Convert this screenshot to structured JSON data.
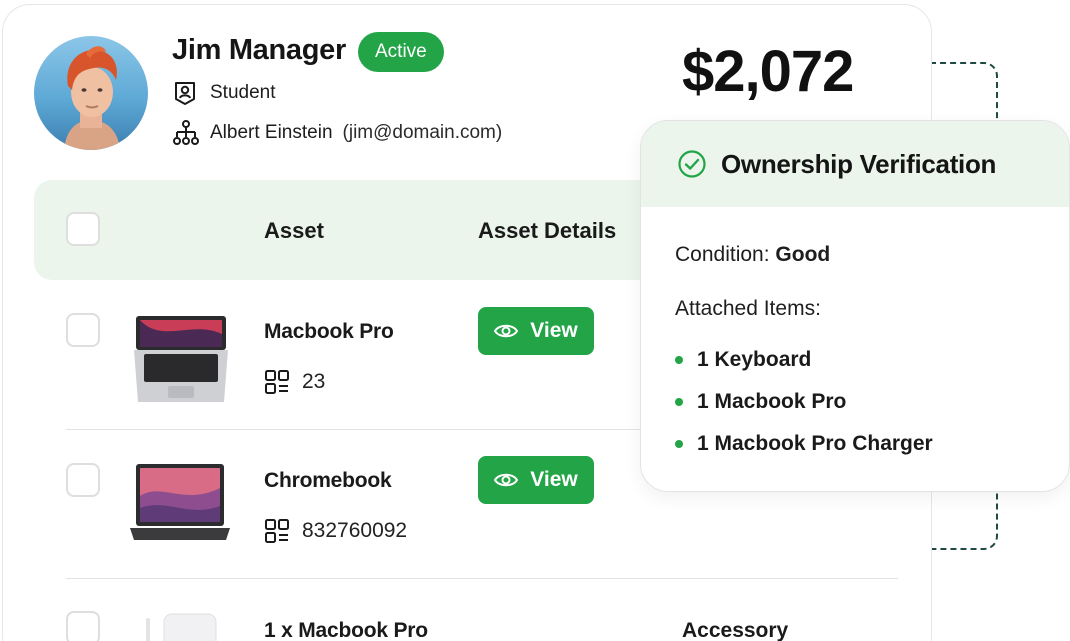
{
  "profile": {
    "name": "Jim Manager",
    "status": "Active",
    "role": "Student",
    "manager_name": "Albert Einstein",
    "manager_email": "(jim@domain.com)",
    "total_value": "$2,072"
  },
  "table": {
    "headers": {
      "asset": "Asset",
      "details": "Asset Details"
    },
    "view_label": "View",
    "rows": [
      {
        "name": "Macbook Pro",
        "asset_id": "23"
      },
      {
        "name": "Chromebook",
        "asset_id": "832760092"
      },
      {
        "name": "1 x Macbook Pro",
        "type": "Accessory"
      }
    ]
  },
  "verification": {
    "title": "Ownership Verification",
    "condition_label": "Condition:",
    "condition_value": "Good",
    "attached_label": "Attached Items:",
    "items": [
      "1 Keyboard",
      "1 Macbook Pro",
      "1 Macbook Pro Charger"
    ]
  },
  "colors": {
    "accent_green": "#22a447",
    "header_tint": "#ebf5ec",
    "connector": "#1f4a44"
  }
}
